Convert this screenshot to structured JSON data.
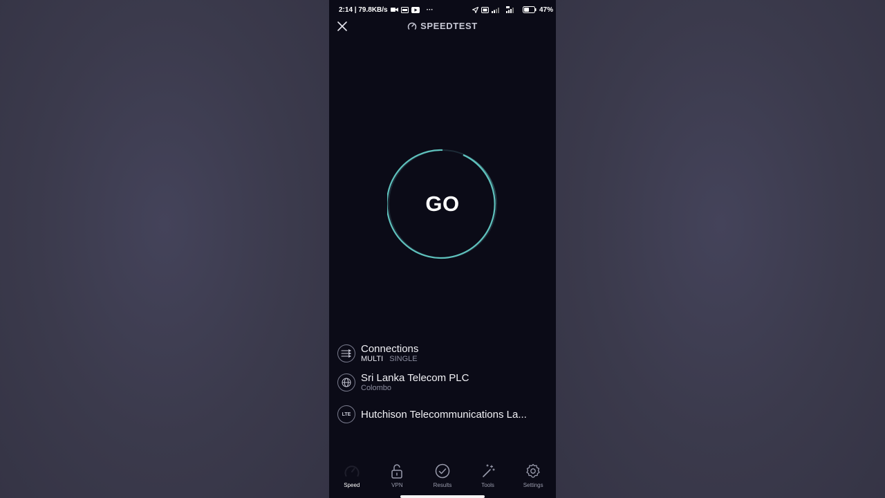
{
  "status_bar": {
    "time_speed": "2:14 | 79.8KB/s",
    "more": "···",
    "battery": "47%"
  },
  "header": {
    "title": "SPEEDTEST"
  },
  "go_button": {
    "label": "GO"
  },
  "connections": {
    "title": "Connections",
    "options": [
      "MULTI",
      "SINGLE"
    ],
    "selected": "MULTI"
  },
  "server": {
    "title": "Sri Lanka Telecom PLC",
    "location": "Colombo"
  },
  "provider": {
    "icon_text": "LTE",
    "title": "Hutchison Telecommunications La..."
  },
  "nav": {
    "items": [
      {
        "label": "Speed",
        "icon": "speedometer-icon",
        "active": true
      },
      {
        "label": "VPN",
        "icon": "lock-icon",
        "active": false
      },
      {
        "label": "Results",
        "icon": "check-circle-icon",
        "active": false
      },
      {
        "label": "Tools",
        "icon": "magic-wand-icon",
        "active": false
      },
      {
        "label": "Settings",
        "icon": "gear-icon",
        "active": false
      }
    ]
  },
  "colors": {
    "accent": "#5fc2bd",
    "background": "#0b0b17"
  }
}
